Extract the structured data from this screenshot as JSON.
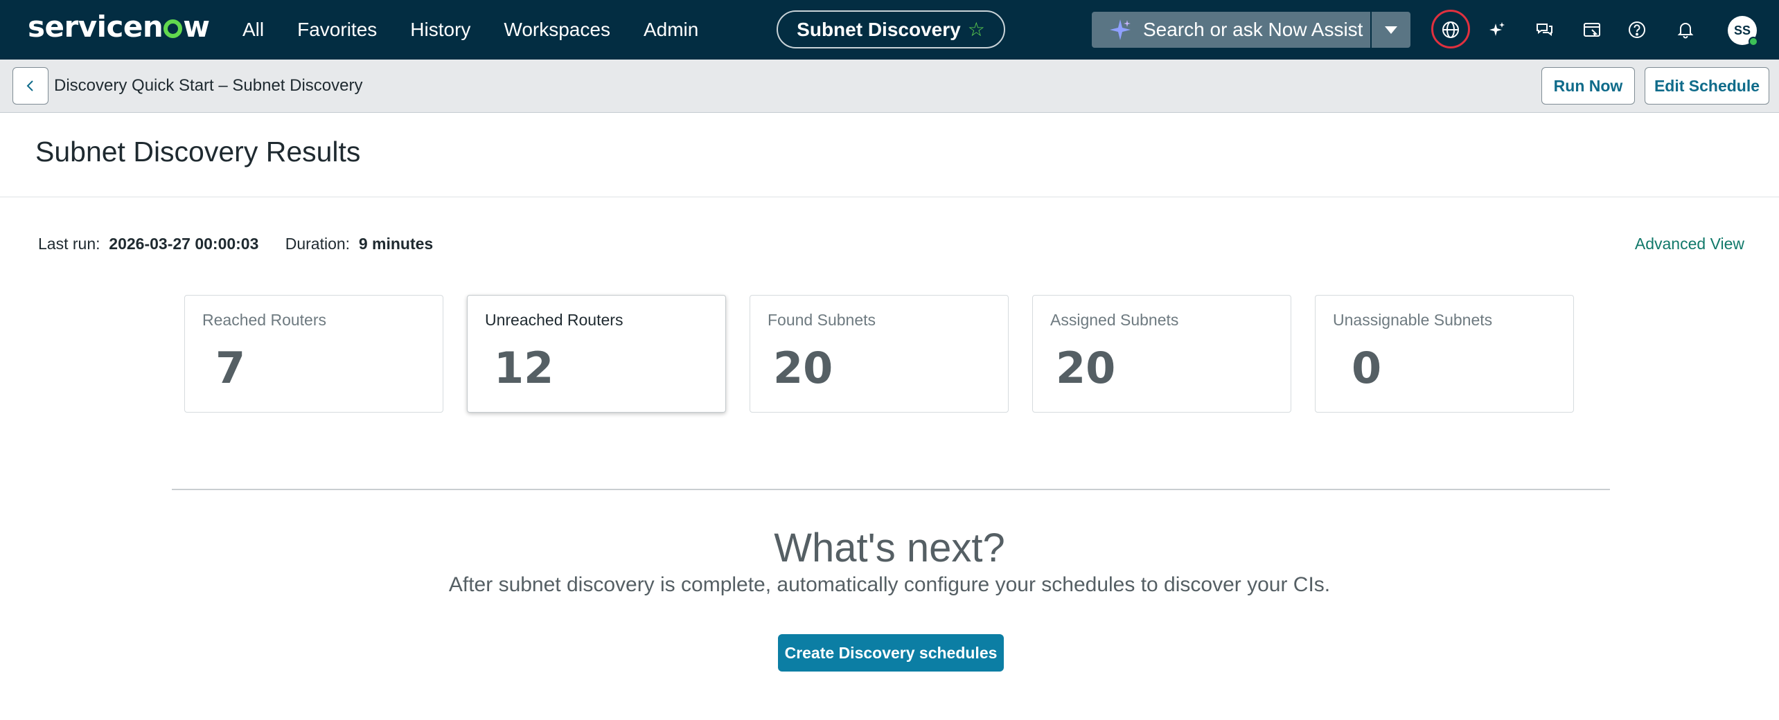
{
  "topnav": {
    "logo": "servicenow",
    "links": [
      "All",
      "Favorites",
      "History",
      "Workspaces",
      "Admin"
    ],
    "context_pill": "Subnet Discovery",
    "search_placeholder": "Search or ask Now Assist",
    "avatar_initials": "SS",
    "icons": [
      "globe-icon",
      "sparkle-icon",
      "chat-icon",
      "workspace-icon",
      "help-icon",
      "bell-icon"
    ]
  },
  "subheader": {
    "breadcrumb": "Discovery Quick Start – Subnet Discovery",
    "run_now": "Run Now",
    "edit_schedule": "Edit Schedule"
  },
  "page": {
    "title": "Subnet Discovery Results",
    "last_run_label": "Last run:",
    "last_run_value": "2026-03-27 00:00:03",
    "duration_label": "Duration:",
    "duration_value": "9 minutes",
    "advanced_view": "Advanced View"
  },
  "cards": [
    {
      "label": "Reached Routers",
      "value": "7"
    },
    {
      "label": "Unreached Routers",
      "value": "12"
    },
    {
      "label": "Found Subnets",
      "value": "20"
    },
    {
      "label": "Assigned Subnets",
      "value": "20"
    },
    {
      "label": "Unassignable Subnets",
      "value": "0"
    }
  ],
  "next": {
    "heading": "What's next?",
    "description": "After subnet discovery is complete, automatically configure your schedules to discover your CIs.",
    "button": "Create Discovery schedules"
  },
  "colors": {
    "nav_bg": "#032d42",
    "accent_green": "#62d84e",
    "primary_button": "#0c7ea4",
    "link_teal": "#11796a",
    "highlight_ring": "#e0313f"
  }
}
